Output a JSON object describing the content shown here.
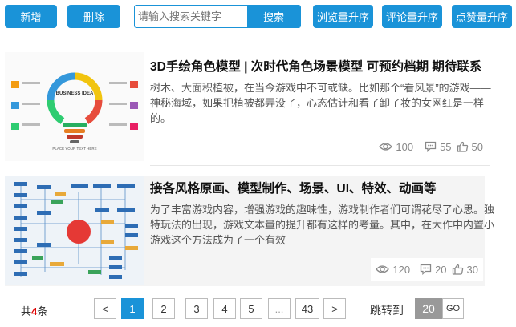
{
  "toolbar": {
    "add_label": "新增",
    "delete_label": "删除",
    "search_placeholder": "请输入搜索关键字",
    "search_label": "搜索",
    "sort_views_label": "浏览量升序",
    "sort_comments_label": "评论量升序",
    "sort_likes_label": "点赞量升序"
  },
  "articles": [
    {
      "title": "3D手绘角色模型 | 次时代角色场景模型 可预约档期 期待联系",
      "description": "树木、大面积植被，在当今游戏中不可或缺。比如那个“看风景”的游戏——神秘海域，如果把植被都弄没了，心态估计和看了卸了妆的女网红是一样的。",
      "thumb_title": "BUSINESS IDEA",
      "thumb_caption": "PLACE YOUR TEXT HERE",
      "views": "100",
      "comments": "55",
      "likes": "50"
    },
    {
      "title": "接各风格原画、模型制作、场景、UI、特效、动画等",
      "description": "为了丰富游戏内容，增强游戏的趣味性，游戏制作者们可谓花尽了心思。独特玩法的出现，游戏文本量的提升都有这样的考量。其中，在大作中内置小游戏这个方法成为了一个有效",
      "views": "120",
      "comments": "20",
      "likes": "30"
    }
  ],
  "pagination": {
    "total_prefix": "共",
    "total_count": "4",
    "total_suffix": "条",
    "prev": "<",
    "pages": [
      "1",
      "2",
      "3",
      "4",
      "5",
      "...",
      "43"
    ],
    "active_page": "1",
    "next": ">",
    "jump_label": "跳转到",
    "jump_value": "20",
    "go_label": "GO"
  },
  "colors": {
    "accent": "#1a93d8",
    "highlight_red": "#dd0000"
  },
  "icons": [
    "eye-icon",
    "comment-icon",
    "thumbs-up-icon"
  ]
}
